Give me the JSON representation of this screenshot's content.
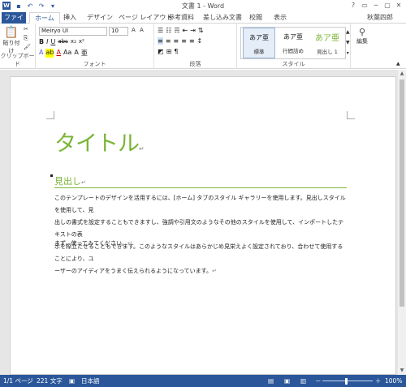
{
  "window": {
    "title": "文書 1 - Word",
    "controls": [
      "?",
      "▭",
      "─",
      "▢",
      "✕"
    ]
  },
  "quick_access": {
    "icons": [
      "save-icon",
      "undo-icon",
      "redo-icon",
      "customize-icon"
    ]
  },
  "tabs": {
    "file": "ファイル",
    "items": [
      "ホーム",
      "挿入",
      "デザイン",
      "ページ レイアウト",
      "参考資料",
      "差し込み文書",
      "校閲",
      "表示"
    ],
    "active": "ホーム",
    "user": "秋葉四郎"
  },
  "ribbon": {
    "clipboard": {
      "paste": "貼り付け",
      "label": "クリップボード"
    },
    "font": {
      "name": "Meiryo UI",
      "size": "10",
      "label": "フォント",
      "format_row": [
        "B",
        "I",
        "U",
        "abc",
        "x₂",
        "x²"
      ]
    },
    "paragraph": {
      "label": "段落"
    },
    "styles": {
      "label": "スタイル",
      "items": [
        {
          "sample": "あア亜",
          "name": "標準"
        },
        {
          "sample": "あア亜",
          "name": "行間詰め"
        },
        {
          "sample": "あア亜",
          "name": "見出し 1"
        }
      ]
    },
    "editing": {
      "label": "編集"
    }
  },
  "document": {
    "title": "タイトル",
    "heading": "見出し",
    "paragraph1": [
      "このテンプレートのデザインを活用するには、[ホーム] タブのスタイル ギャラリーを使用します。見出しスタイルを使用して、見",
      "出しの書式を設定することもできますし、強調や引用文のようなその他のスタイルを使用して、インポートしたテキストの表",
      "示を際立たせることもできます。このようなスタイルはあらかじめ見栄えよく設定されており、合わせて使用することにより、ユ",
      "ーザーのアイディアをうまく伝えられるようになっています。"
    ],
    "paragraph2": "まず、使ってみてください。",
    "para_mark": "↵"
  },
  "status": {
    "page": "1/1 ページ",
    "words": "221 文字",
    "language": "日本語",
    "zoom": "100%",
    "zoom_minus": "－",
    "zoom_plus": "＋"
  },
  "colors": {
    "accent": "#2b579a",
    "title_green": "#7ab536"
  }
}
